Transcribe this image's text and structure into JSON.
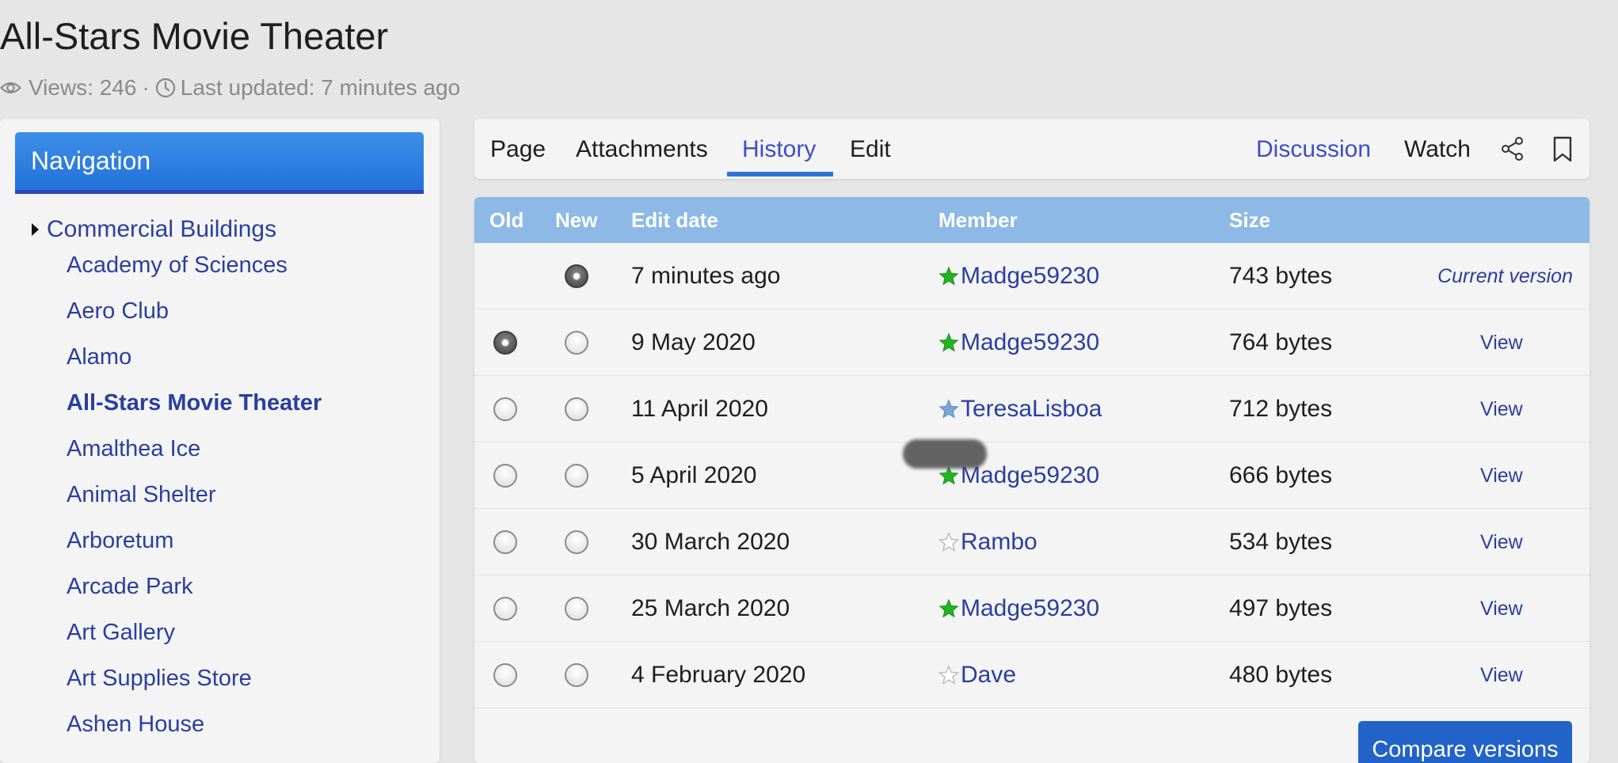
{
  "page": {
    "title": "All-Stars Movie Theater",
    "views_label": "Views: 246",
    "separator": "·",
    "last_updated_label": "Last updated: 7 minutes ago"
  },
  "navigation": {
    "header": "Navigation",
    "parent": "Commercial Buildings",
    "items": [
      {
        "label": "Academy of Sciences"
      },
      {
        "label": "Aero Club"
      },
      {
        "label": "Alamo"
      },
      {
        "label": "All-Stars Movie Theater",
        "active": true
      },
      {
        "label": "Amalthea Ice"
      },
      {
        "label": "Animal Shelter"
      },
      {
        "label": "Arboretum"
      },
      {
        "label": "Arcade Park"
      },
      {
        "label": "Art Gallery"
      },
      {
        "label": "Art Supplies Store"
      },
      {
        "label": "Ashen House"
      }
    ]
  },
  "tabs": {
    "page": "Page",
    "attachments": "Attachments",
    "history": "History",
    "edit": "Edit",
    "discussion": "Discussion",
    "watch": "Watch",
    "active": "History"
  },
  "history": {
    "columns": {
      "old": "Old",
      "new": "New",
      "edit_date": "Edit date",
      "member": "Member",
      "size": "Size"
    },
    "rows": [
      {
        "date": "7 minutes ago",
        "member": "Madge59230",
        "star": "green-star-icon",
        "size": "743 bytes",
        "action": "Current version",
        "old_radio": null,
        "new_radio": "checked"
      },
      {
        "date": "9 May 2020",
        "member": "Madge59230",
        "star": "green-star-icon",
        "size": "764 bytes",
        "action": "View",
        "old_radio": "checked",
        "new_radio": "unchecked"
      },
      {
        "date": "11 April 2020",
        "member": "TeresaLisboa",
        "star": "blue-star-icon",
        "size": "712 bytes",
        "action": "View",
        "old_radio": "unchecked",
        "new_radio": "unchecked"
      },
      {
        "date": "5 April 2020",
        "member": "Madge59230",
        "star": "green-star-icon",
        "size": "666 bytes",
        "action": "View",
        "old_radio": "unchecked",
        "new_radio": "unchecked"
      },
      {
        "date": "30 March 2020",
        "member": "Rambo",
        "star": "white-star-icon",
        "size": "534 bytes",
        "action": "View",
        "old_radio": "unchecked",
        "new_radio": "unchecked"
      },
      {
        "date": "25 March 2020",
        "member": "Madge59230",
        "star": "green-star-icon",
        "size": "497 bytes",
        "action": "View",
        "old_radio": "unchecked",
        "new_radio": "unchecked"
      },
      {
        "date": "4 February 2020",
        "member": "Dave",
        "star": "white-star-icon",
        "size": "480 bytes",
        "action": "View",
        "old_radio": "unchecked",
        "new_radio": "unchecked"
      }
    ],
    "compare_button": "Compare versions"
  },
  "colors": {
    "accent": "#2f72d8",
    "link": "#2a3f9e",
    "table_header": "#8db9e6",
    "star_green": "#22b422",
    "star_blue": "#7aa6d8",
    "star_white": "#ffffff"
  }
}
